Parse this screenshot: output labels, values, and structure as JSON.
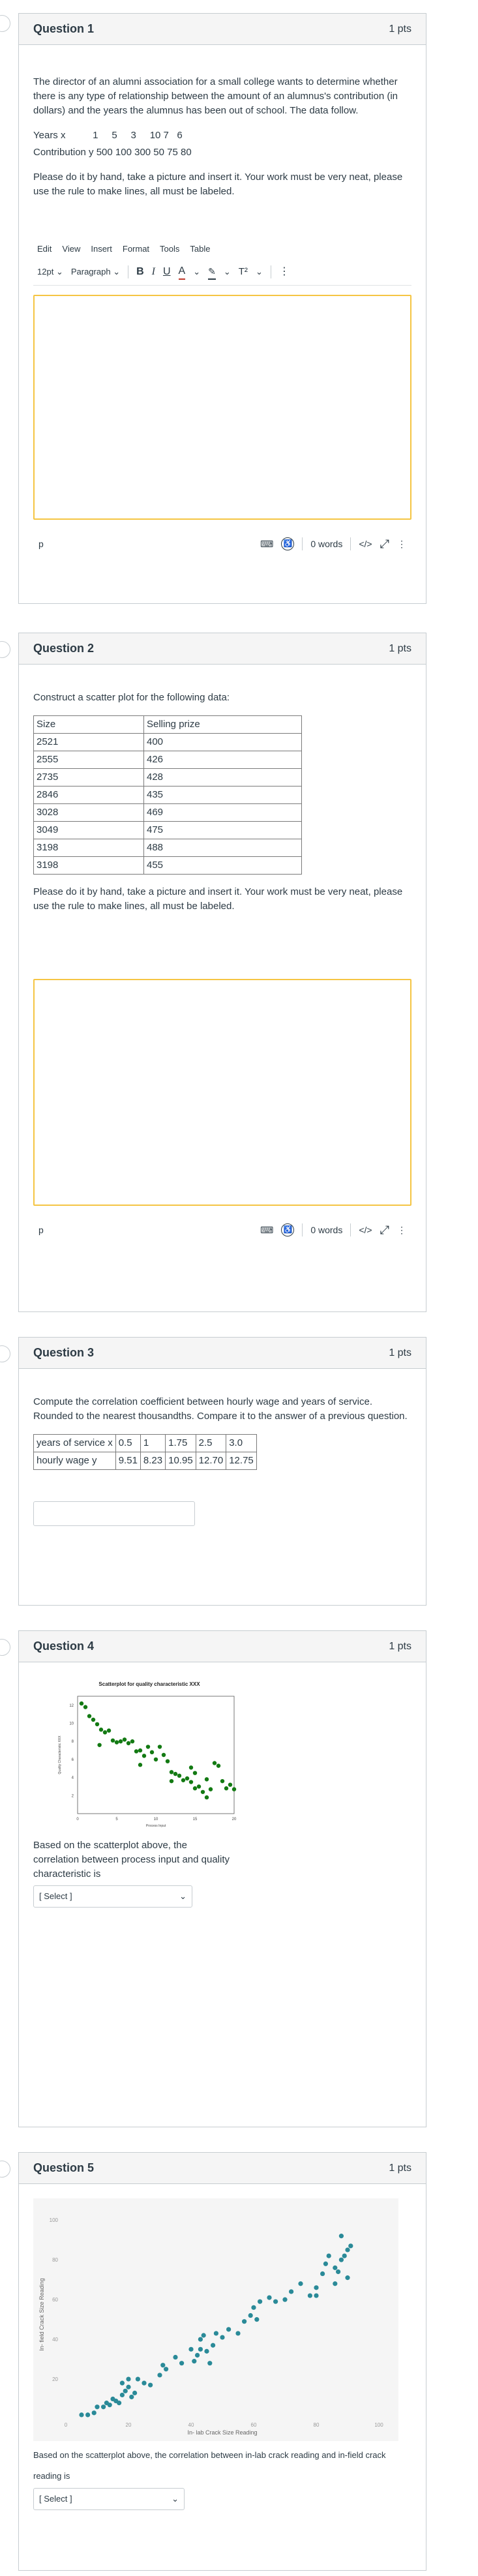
{
  "questions": [
    {
      "title": "Question 1",
      "points": "1 pts",
      "prompt": "The director of an alumni association for a small college wants to determine whether there is any type of relationship between the amount of an alumnus's contribution (in dollars) and the years the alumnus has been out of school. The data follow.",
      "row_years": "Years x          1     5     3     10 7   6",
      "row_contrib": "Contribution y 500 100 300 50 75 80",
      "instructions": "Please do it by hand, take a picture and insert it. Your work must be very neat, please use the rule to make lines, all must be labeled."
    },
    {
      "title": "Question 2",
      "points": "1 pts",
      "prompt": "Construct a scatter plot for the following data:",
      "table_headers": [
        "Size",
        "Selling prize"
      ],
      "table_rows": [
        [
          "2521",
          "400"
        ],
        [
          "2555",
          "426"
        ],
        [
          "2735",
          "428"
        ],
        [
          "2846",
          "435"
        ],
        [
          "3028",
          "469"
        ],
        [
          "3049",
          "475"
        ],
        [
          "3198",
          "488"
        ],
        [
          "3198",
          "455"
        ]
      ],
      "instructions": "Please do it by hand, take a picture and insert it. Your work must be very neat, please use the rule to make lines, all must be labeled."
    },
    {
      "title": "Question 3",
      "points": "1 pts",
      "prompt": "Compute the correlation coefficient between hourly wage and years of service. Rounded to the nearest thousandths. Compare it to the answer of a previous question.",
      "table": [
        [
          "years of service x",
          "0.5",
          "1",
          "1.75",
          "2.5",
          "3.0"
        ],
        [
          "hourly wage y",
          "9.51",
          "8.23",
          "10.95",
          "12.70",
          "12.75"
        ]
      ]
    },
    {
      "title": "Question 4",
      "points": "1 pts",
      "prompt": "Based on the scatterplot above,  the correlation between process input and quality characteristic is",
      "select": "[ Select ]"
    },
    {
      "title": "Question 5",
      "points": "1 pts",
      "prompt": "Based on the scatterplot above,  the correlation between in-lab crack reading and in-field crack reading is",
      "select": "[ Select ]"
    }
  ],
  "editor": {
    "menu": [
      "Edit",
      "View",
      "Insert",
      "Format",
      "Tools",
      "Table"
    ],
    "font_size": "12pt",
    "block_format": "Paragraph",
    "path": "p",
    "word_count": "0 words",
    "html_toggle": "</>"
  },
  "chart_data": [
    {
      "type": "scatter",
      "title": "Scatterplot for quality characteristic XXX",
      "xlabel": "Process Input",
      "ylabel": "Quality Characteristic XXX",
      "x_ticks": [
        "0",
        "5",
        "10",
        "15",
        "20"
      ],
      "y_ticks": [
        "2",
        "4",
        "6",
        "8",
        "10",
        "12"
      ],
      "xlim": [
        0,
        20
      ],
      "ylim": [
        0,
        13
      ],
      "color": "#137a13",
      "points": [
        [
          0.5,
          12.2
        ],
        [
          1.0,
          11.8
        ],
        [
          1.5,
          10.8
        ],
        [
          2.0,
          10.4
        ],
        [
          2.5,
          9.9
        ],
        [
          3.0,
          9.3
        ],
        [
          3.5,
          9.0
        ],
        [
          2.8,
          7.6
        ],
        [
          4.0,
          9.2
        ],
        [
          4.5,
          8.1
        ],
        [
          5.0,
          7.9
        ],
        [
          5.5,
          8.0
        ],
        [
          6.0,
          8.2
        ],
        [
          6.5,
          7.8
        ],
        [
          7.0,
          8.0
        ],
        [
          7.5,
          6.9
        ],
        [
          8.0,
          7.0
        ],
        [
          8.5,
          6.4
        ],
        [
          8.0,
          5.4
        ],
        [
          9.0,
          7.4
        ],
        [
          9.5,
          6.8
        ],
        [
          10.0,
          6.0
        ],
        [
          10.5,
          7.4
        ],
        [
          11.0,
          6.5
        ],
        [
          11.5,
          5.8
        ],
        [
          12.0,
          4.6
        ],
        [
          12.0,
          3.6
        ],
        [
          12.5,
          4.4
        ],
        [
          13.0,
          4.2
        ],
        [
          13.5,
          3.7
        ],
        [
          14.0,
          3.9
        ],
        [
          14.5,
          3.5
        ],
        [
          14.5,
          5.1
        ],
        [
          15.0,
          4.5
        ],
        [
          15.5,
          3.0
        ],
        [
          16.0,
          2.4
        ],
        [
          16.5,
          3.8
        ],
        [
          17.0,
          2.7
        ],
        [
          17.5,
          5.6
        ],
        [
          18.0,
          5.3
        ],
        [
          18.5,
          3.6
        ],
        [
          19.0,
          2.8
        ],
        [
          19.5,
          3.2
        ],
        [
          20.0,
          2.7
        ],
        [
          16.5,
          1.8
        ],
        [
          15.0,
          2.8
        ]
      ]
    },
    {
      "type": "scatter",
      "title": "",
      "xlabel": "In- lab Crack Size Reading",
      "ylabel": "In- field Crack Size Reading",
      "x_ticks": [
        "0",
        "20",
        "40",
        "60",
        "80",
        "100"
      ],
      "y_ticks": [
        "20",
        "40",
        "60",
        "80",
        "100"
      ],
      "xlim": [
        0,
        100
      ],
      "ylim": [
        0,
        105
      ],
      "color": "#2a8a98",
      "points": [
        [
          5,
          2
        ],
        [
          7,
          2
        ],
        [
          9,
          3
        ],
        [
          10,
          6
        ],
        [
          12,
          6
        ],
        [
          13,
          8
        ],
        [
          14,
          7
        ],
        [
          15,
          10
        ],
        [
          16,
          9
        ],
        [
          17,
          8
        ],
        [
          18,
          12
        ],
        [
          18,
          18
        ],
        [
          19,
          14
        ],
        [
          20,
          16
        ],
        [
          20,
          20
        ],
        [
          21,
          11
        ],
        [
          22,
          13
        ],
        [
          23,
          20
        ],
        [
          25,
          18
        ],
        [
          27,
          17
        ],
        [
          30,
          22
        ],
        [
          31,
          27
        ],
        [
          32,
          25
        ],
        [
          35,
          31
        ],
        [
          37,
          28
        ],
        [
          40,
          35
        ],
        [
          41,
          29
        ],
        [
          42,
          32
        ],
        [
          43,
          35
        ],
        [
          43,
          40
        ],
        [
          44,
          42
        ],
        [
          45,
          34
        ],
        [
          46,
          28
        ],
        [
          47,
          37
        ],
        [
          48,
          43
        ],
        [
          50,
          41
        ],
        [
          52,
          45
        ],
        [
          55,
          43
        ],
        [
          57,
          49
        ],
        [
          59,
          52
        ],
        [
          60,
          56
        ],
        [
          61,
          50
        ],
        [
          62,
          59
        ],
        [
          65,
          61
        ],
        [
          67,
          59
        ],
        [
          70,
          60
        ],
        [
          72,
          64
        ],
        [
          75,
          68
        ],
        [
          78,
          62
        ],
        [
          80,
          66
        ],
        [
          80,
          62
        ],
        [
          82,
          73
        ],
        [
          83,
          78
        ],
        [
          84,
          82
        ],
        [
          86,
          76
        ],
        [
          86,
          68
        ],
        [
          87,
          74
        ],
        [
          88,
          80
        ],
        [
          88,
          92
        ],
        [
          89,
          82
        ],
        [
          90,
          85
        ],
        [
          90,
          71
        ],
        [
          91,
          87
        ]
      ]
    }
  ]
}
